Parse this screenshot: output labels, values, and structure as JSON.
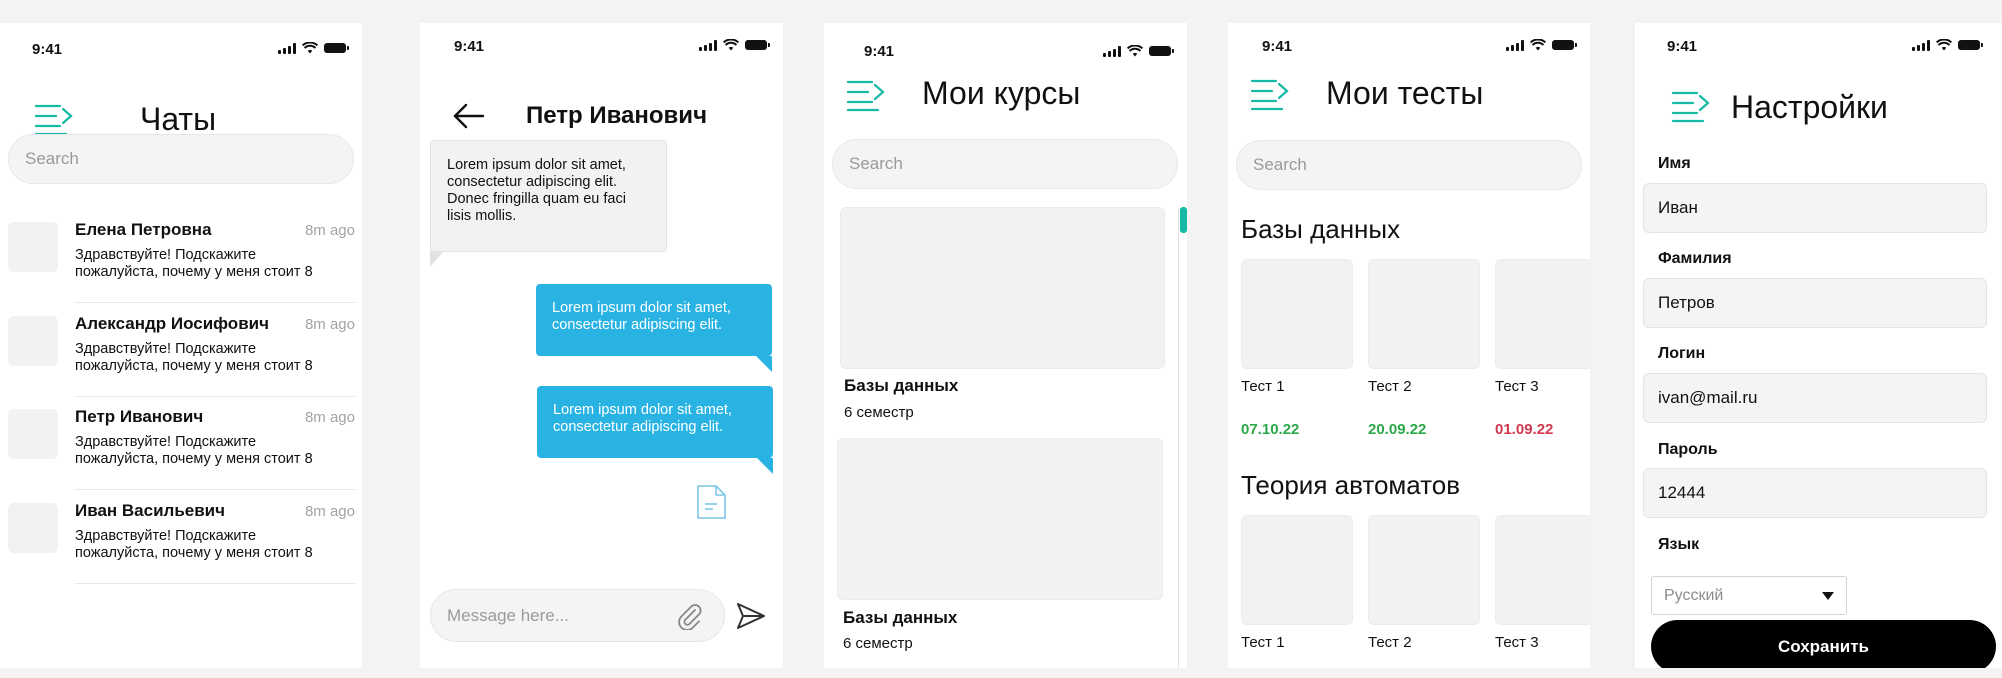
{
  "status_time": "9:41",
  "accent_color": "#16B8A6",
  "chats_screen": {
    "title": "Чаты",
    "search_placeholder": "Search",
    "items": [
      {
        "name": "Елена Петровна",
        "time": "8m ago",
        "message": "Здравствуйте! Подскажите пожалуйста, почему у меня стоит 8"
      },
      {
        "name": "Александр Иосифович",
        "time": "8m ago",
        "message": "Здравствуйте! Подскажите пожалуйста, почему у меня стоит 8"
      },
      {
        "name": "Петр Иванович",
        "time": "8m ago",
        "message": "Здравствуйте! Подскажите пожалуйста, почему у меня стоит 8"
      },
      {
        "name": "Иван Васильевич",
        "time": "8m ago",
        "message": "Здравствуйте! Подскажите пожалуйста, почему у меня стоит 8"
      }
    ]
  },
  "conversation_screen": {
    "title": "Петр Иванович",
    "incoming_message": "Lorem ipsum dolor sit amet, consectetur adipiscing elit. Donec fringilla quam eu faci lisis mollis.",
    "outgoing_messages": [
      "Lorem ipsum dolor sit amet, consectetur adipiscing elit.",
      "Lorem ipsum dolor sit amet, consectetur adipiscing elit."
    ],
    "input_placeholder": "Message here...",
    "outgoing_color": "#29B3E3"
  },
  "courses_screen": {
    "title": "Мои курсы",
    "search_placeholder": "Search",
    "courses": [
      {
        "name": "Базы данных",
        "semester": "6 семестр"
      },
      {
        "name": "Базы данных",
        "semester": "6 семестр"
      }
    ]
  },
  "tests_screen": {
    "title": "Мои тесты",
    "search_placeholder": "Search",
    "sections": [
      {
        "name": "Базы данных",
        "tests": [
          {
            "name": "Тест 1",
            "date": "07.10.22",
            "status": "ok"
          },
          {
            "name": "Тест 2",
            "date": "20.09.22",
            "status": "ok"
          },
          {
            "name": "Тест 3",
            "date": "01.09.22",
            "status": "overdue"
          }
        ]
      },
      {
        "name": "Теория автоматов",
        "tests": [
          {
            "name": "Тест 1"
          },
          {
            "name": "Тест 2"
          },
          {
            "name": "Тест 3"
          }
        ]
      }
    ],
    "colors": {
      "ok": "#2CA84A",
      "overdue": "#D2384E"
    }
  },
  "settings_screen": {
    "title": "Настройки",
    "fields": [
      {
        "label": "Имя",
        "value": "Иван"
      },
      {
        "label": "Фамилия",
        "value": "Петров"
      },
      {
        "label": "Логин",
        "value": "ivan@mail.ru"
      },
      {
        "label": "Пароль",
        "value": "12444"
      }
    ],
    "language_label": "Язык",
    "language_value": "Русский",
    "save_label": "Сохранить"
  }
}
